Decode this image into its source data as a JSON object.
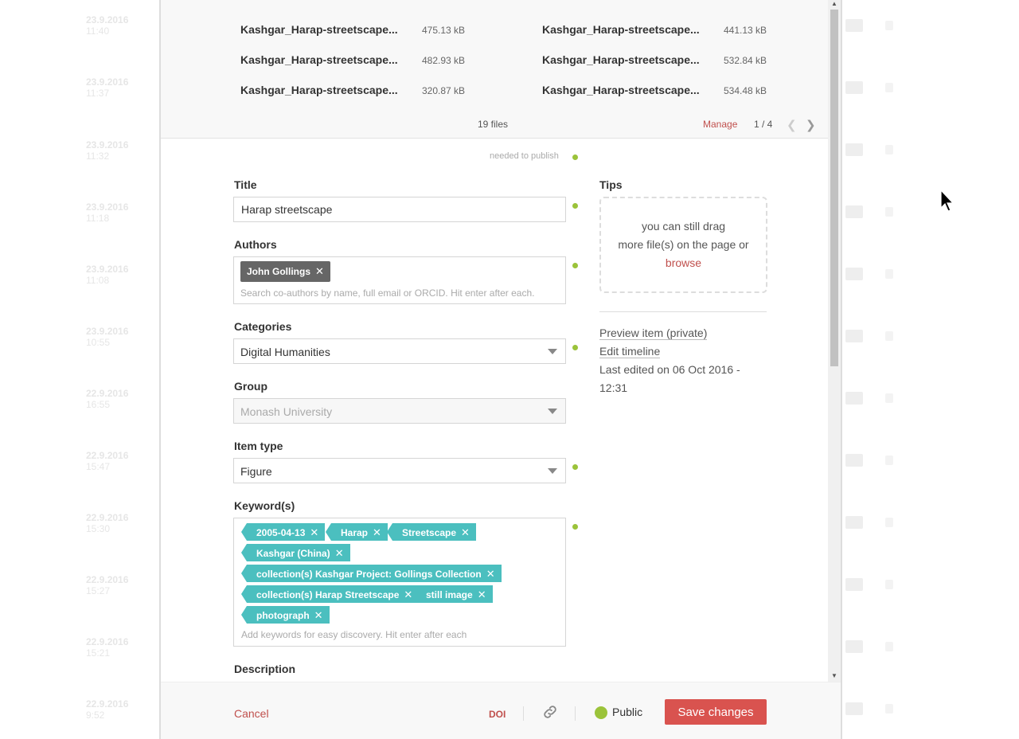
{
  "background": {
    "dates": [
      {
        "date": "23.9.2016",
        "time": "11:40"
      },
      {
        "date": "23.9.2016",
        "time": "11:37"
      },
      {
        "date": "23.9.2016",
        "time": "11:32"
      },
      {
        "date": "23.9.2016",
        "time": "11:18"
      },
      {
        "date": "23.9.2016",
        "time": "11:08"
      },
      {
        "date": "23.9.2016",
        "time": "10:55"
      },
      {
        "date": "22.9.2016",
        "time": "16:55"
      },
      {
        "date": "22.9.2016",
        "time": "15:47"
      },
      {
        "date": "22.9.2016",
        "time": "15:30"
      },
      {
        "date": "22.9.2016",
        "time": "15:27"
      },
      {
        "date": "22.9.2016",
        "time": "15:21"
      },
      {
        "date": "22.9.2016",
        "time": "9:52"
      }
    ]
  },
  "files": {
    "items": [
      {
        "name": "Kashgar_Harap-streetscape...",
        "size": "475.13 kB"
      },
      {
        "name": "Kashgar_Harap-streetscape...",
        "size": "441.13 kB"
      },
      {
        "name": "Kashgar_Harap-streetscape...",
        "size": "482.93 kB"
      },
      {
        "name": "Kashgar_Harap-streetscape...",
        "size": "532.84 kB"
      },
      {
        "name": "Kashgar_Harap-streetscape...",
        "size": "320.87 kB"
      },
      {
        "name": "Kashgar_Harap-streetscape...",
        "size": "534.48 kB"
      }
    ],
    "count": "19 files",
    "manage": "Manage",
    "page": "1 / 4"
  },
  "form": {
    "needed_note": "needed to publish",
    "title_label": "Title",
    "title_value": "Harap streetscape",
    "authors_label": "Authors",
    "author_tag": "John Gollings",
    "authors_placeholder": "Search co-authors by name, full email or ORCID. Hit enter after each.",
    "categories_label": "Categories",
    "categories_value": "Digital Humanities",
    "group_label": "Group",
    "group_value": "Monash University",
    "itemtype_label": "Item type",
    "itemtype_value": "Figure",
    "keywords_label": "Keyword(s)",
    "keywords": [
      "2005-04-13",
      "Harap",
      "Streetscape",
      "Kashgar (China)",
      "collection(s) Kashgar Project: Gollings Collection",
      "collection(s) Harap Streetscape",
      "still image",
      "photograph"
    ],
    "keywords_placeholder": "Add keywords for easy discovery. Hit enter after each",
    "description_label": "Description",
    "remove_glyph": "✕"
  },
  "sidebar": {
    "tips_title": "Tips",
    "drop_line1": "you can still drag",
    "drop_line2": "more file(s) on the page or",
    "browse": "browse",
    "preview": "Preview item (private)",
    "timeline": "Edit timeline",
    "last_edited": "Last edited on 06 Oct 2016 - 12:31"
  },
  "footer": {
    "cancel": "Cancel",
    "doi": "DOI",
    "public": "Public",
    "save": "Save changes"
  },
  "colors": {
    "accent_red": "#d9534f",
    "keyword_teal": "#4bbfbf",
    "status_green": "#9bc33a"
  }
}
